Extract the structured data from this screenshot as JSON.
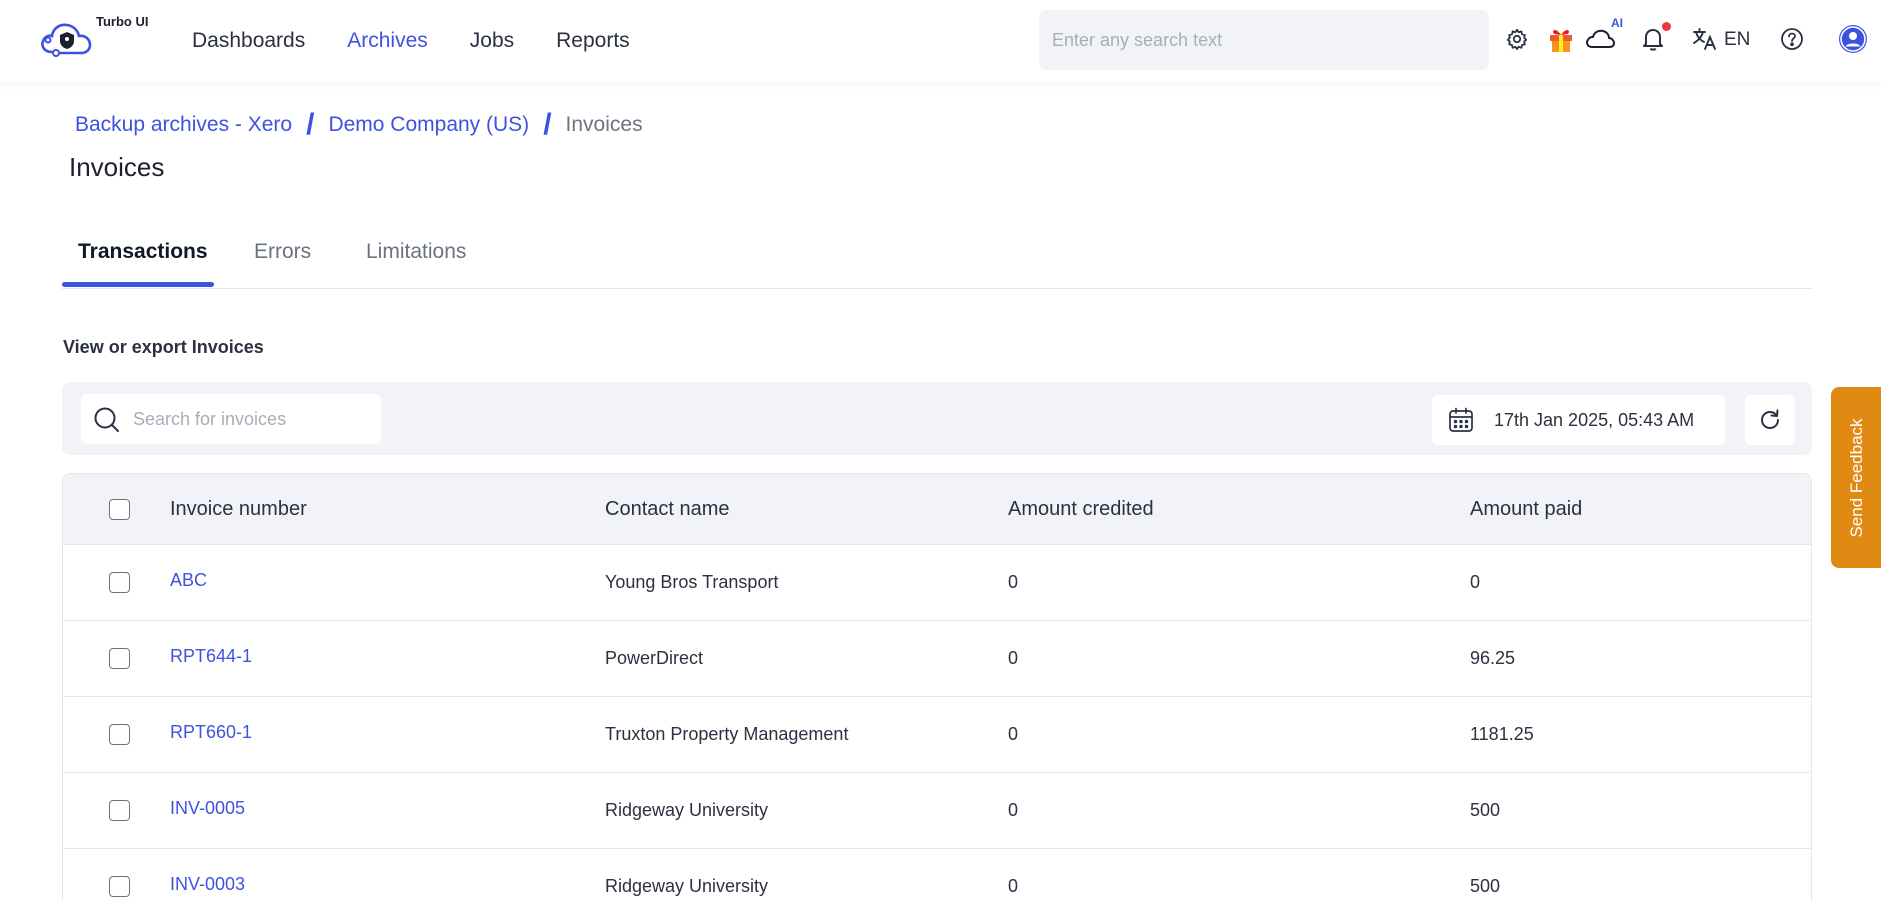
{
  "app": {
    "brand": "Turbo UI",
    "ai_badge": "AI",
    "language": "EN"
  },
  "nav": {
    "items": [
      {
        "label": "Dashboards",
        "active": false
      },
      {
        "label": "Archives",
        "active": true
      },
      {
        "label": "Jobs",
        "active": false
      },
      {
        "label": "Reports",
        "active": false
      }
    ]
  },
  "header": {
    "search_placeholder": "Enter any search text",
    "icons": [
      "gear-icon",
      "gift-icon",
      "cloud-ai-icon",
      "bell-icon",
      "translate-icon",
      "help-icon",
      "user-avatar-icon"
    ],
    "has_notification": true
  },
  "breadcrumb": {
    "items": [
      {
        "label": "Backup archives - Xero",
        "link": true
      },
      {
        "label": "Demo Company (US)",
        "link": true
      },
      {
        "label": "Invoices",
        "link": false
      }
    ]
  },
  "page": {
    "title": "Invoices",
    "section_label": "View or export Invoices"
  },
  "tabs": [
    {
      "label": "Transactions",
      "active": true
    },
    {
      "label": "Errors",
      "active": false
    },
    {
      "label": "Limitations",
      "active": false
    }
  ],
  "toolbar": {
    "search_placeholder": "Search for invoices",
    "date": "17th Jan 2025, 05:43 AM"
  },
  "table": {
    "columns": [
      "Invoice number",
      "Contact name",
      "Amount credited",
      "Amount paid"
    ],
    "rows": [
      {
        "invoice_number": "ABC",
        "contact_name": "Young Bros Transport",
        "amount_credited": "0",
        "amount_paid": "0"
      },
      {
        "invoice_number": "RPT644-1",
        "contact_name": "PowerDirect",
        "amount_credited": "0",
        "amount_paid": "96.25"
      },
      {
        "invoice_number": "RPT660-1",
        "contact_name": "Truxton Property Management",
        "amount_credited": "0",
        "amount_paid": "1181.25"
      },
      {
        "invoice_number": "INV-0005",
        "contact_name": "Ridgeway University",
        "amount_credited": "0",
        "amount_paid": "500"
      },
      {
        "invoice_number": "INV-0003",
        "contact_name": "Ridgeway University",
        "amount_credited": "0",
        "amount_paid": "500"
      }
    ]
  },
  "feedback": {
    "label": "Send Feedback"
  },
  "colors": {
    "accent": "#3e52e0",
    "feedback": "#e08a14",
    "notification": "#e5393b",
    "toolbar_bg": "#f1f3f8"
  }
}
